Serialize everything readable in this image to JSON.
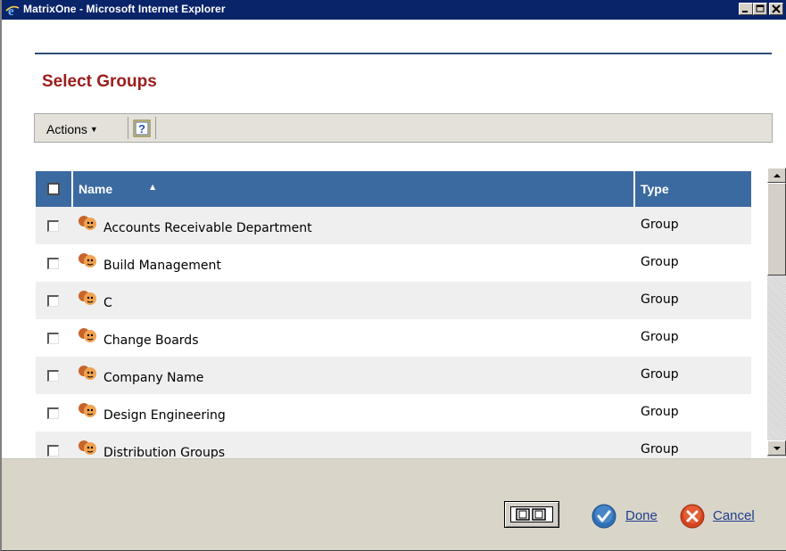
{
  "window": {
    "title": "MatrixOne - Microsoft Internet Explorer"
  },
  "page": {
    "title": "Select Groups"
  },
  "toolbar": {
    "actions_label": "Actions",
    "actions_caret": "▼",
    "help_icon": "help-icon"
  },
  "table": {
    "columns": {
      "name": "Name",
      "type": "Type"
    },
    "sort_indicator": "▲",
    "rows": [
      {
        "name": "Accounts Receivable Department",
        "type": "Group"
      },
      {
        "name": "Build Management",
        "type": "Group"
      },
      {
        "name": "C",
        "type": "Group"
      },
      {
        "name": "Change Boards",
        "type": "Group"
      },
      {
        "name": "Company Name",
        "type": "Group"
      },
      {
        "name": "Design Engineering",
        "type": "Group"
      },
      {
        "name": "Distribution Groups",
        "type": "Group"
      }
    ]
  },
  "footer": {
    "done_label": "Done",
    "cancel_label": "Cancel"
  },
  "colors": {
    "title_bar": "#0a246a",
    "page_title": "#9b1c1c",
    "table_header": "#3b6aa0",
    "link": "#1f3e8c",
    "done_icon": "#2f6fb5",
    "cancel_icon": "#d2451e"
  }
}
